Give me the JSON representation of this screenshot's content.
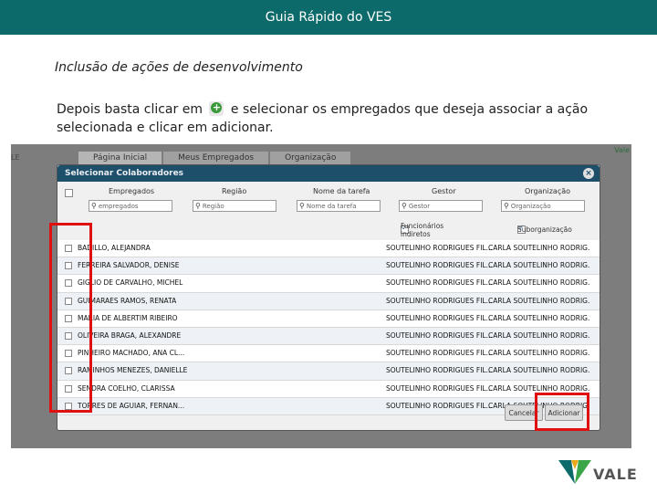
{
  "header": {
    "title": "Guia Rápido do VES"
  },
  "subtitle": "Inclusão de ações de desenvolvimento",
  "instruction": {
    "before": "Depois basta clicar em",
    "after": "e selecionar os empregados que deseja associar a ação selecionada e clicar em adicionar."
  },
  "screenshot": {
    "tabs": [
      {
        "label": "Página Inicial",
        "active": true
      },
      {
        "label": "Meus Empregados",
        "active": false
      },
      {
        "label": "Organização",
        "active": false
      }
    ],
    "logo_text": "Vale",
    "dialog": {
      "title": "Selecionar Colaboradores",
      "close_glyph": "×",
      "columns": [
        "Empregados",
        "Região",
        "Nome da tarefa",
        "Gestor",
        "Organização"
      ],
      "filter_placeholders": [
        "empregados",
        "Região",
        "Nome da tarefa",
        "Gestor",
        "Organização"
      ],
      "options": [
        {
          "label": "Funcionários indiretos",
          "checked": true
        },
        {
          "label": "Suborganização",
          "checked": true
        }
      ],
      "rows": [
        {
          "name": "BADILLO, ALEJANDRA",
          "gestor": "SOUTELINHO RODRIGUES FIL...",
          "org": "CARLA SOUTELINHO RODRIG."
        },
        {
          "name": "FERREIRA SALVADOR, DENISE",
          "gestor": "SOUTELINHO RODRIGUES FIL...",
          "org": "CARLA SOUTELINHO RODRIG."
        },
        {
          "name": "GIGLIO DE CARVALHO, MICHEL",
          "gestor": "SOUTELINHO RODRIGUES FIL...",
          "org": "CARLA SOUTELINHO RODRIG."
        },
        {
          "name": "GUIMARAES RAMOS, RENATA",
          "gestor": "SOUTELINHO RODRIGUES FIL...",
          "org": "CARLA SOUTELINHO RODRIG."
        },
        {
          "name": "MARIA DE ALBERTIM RIBEIRO",
          "gestor": "SOUTELINHO RODRIGUES FIL...",
          "org": "CARLA SOUTELINHO RODRIG."
        },
        {
          "name": "OLIVEIRA BRAGA, ALEXANDRE",
          "gestor": "SOUTELINHO RODRIGUES FIL...",
          "org": "CARLA SOUTELINHO RODRIG."
        },
        {
          "name": "PINHEIRO MACHADO, ANA CL...",
          "gestor": "SOUTELINHO RODRIGUES FIL...",
          "org": "CARLA SOUTELINHO RODRIG."
        },
        {
          "name": "RAMINHOS MENEZES, DANIELLE",
          "gestor": "SOUTELINHO RODRIGUES FIL...",
          "org": "CARLA SOUTELINHO RODRIG."
        },
        {
          "name": "SENDRA COELHO, CLARISSA",
          "gestor": "SOUTELINHO RODRIGUES FIL...",
          "org": "CARLA SOUTELINHO RODRIG."
        },
        {
          "name": "TORRES DE AGUIAR, FERNAN...",
          "gestor": "SOUTELINHO RODRIGUES FIL...",
          "org": "CARLA SOUTELINHO RODRIG."
        }
      ],
      "cancel_label": "Cancelar",
      "add_label": "Adicionar"
    }
  },
  "brand": {
    "name": "VALE",
    "teal": "#0c6a6a",
    "green": "#3aa648",
    "gold": "#e8a817"
  },
  "highlight_color": "#e01010"
}
